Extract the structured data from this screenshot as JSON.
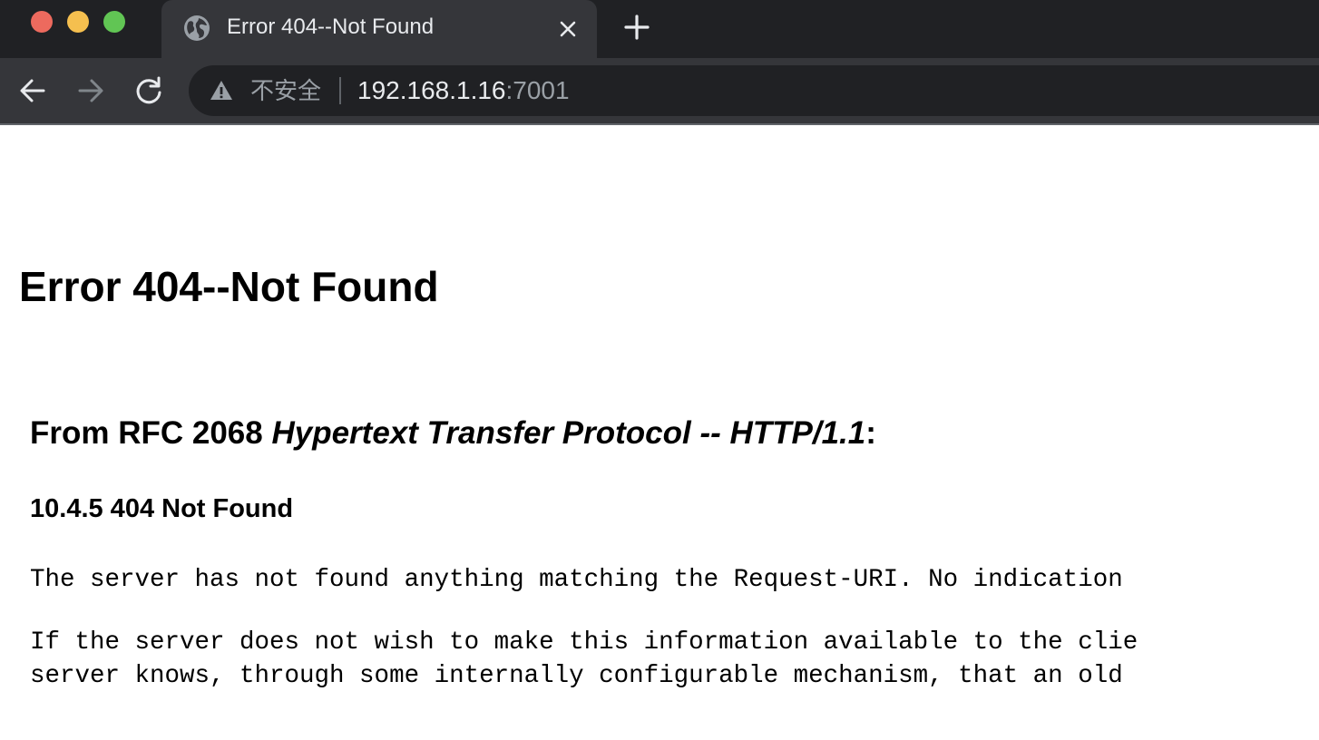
{
  "window": {
    "controls": {
      "close_color": "#ed6a5e",
      "minimize_color": "#f5bf4f",
      "maximize_color": "#61c554"
    }
  },
  "tab": {
    "favicon": "globe-icon",
    "title": "Error 404--Not Found",
    "close_icon": "close-icon"
  },
  "new_tab_icon": "plus-icon",
  "toolbar": {
    "back_icon": "arrow-left-icon",
    "forward_icon": "arrow-right-icon",
    "reload_icon": "reload-icon",
    "omnibox": {
      "security_icon": "warning-triangle-icon",
      "security_label": "不安全",
      "url_host": "192.168.1.16",
      "url_port": ":7001"
    }
  },
  "page": {
    "heading": "Error 404--Not Found",
    "rfc_prefix": "From RFC 2068 ",
    "rfc_title": "Hypertext Transfer Protocol -- HTTP/1.1",
    "rfc_suffix": ":",
    "section_title": "10.4.5 404 Not Found",
    "paragraph_1": "The server has not found anything matching the Request-URI. No indication",
    "paragraph_2_line_1": "If the server does not wish to make this information available to the clie",
    "paragraph_2_line_2": "server knows, through some internally configurable mechanism, that an old"
  },
  "colors": {
    "tabstrip_bg": "#202124",
    "toolbar_bg": "#35363a",
    "omnibox_bg": "#202124",
    "text_light": "#e8eaed",
    "text_muted": "#9aa0a6",
    "page_bg": "#ffffff"
  }
}
